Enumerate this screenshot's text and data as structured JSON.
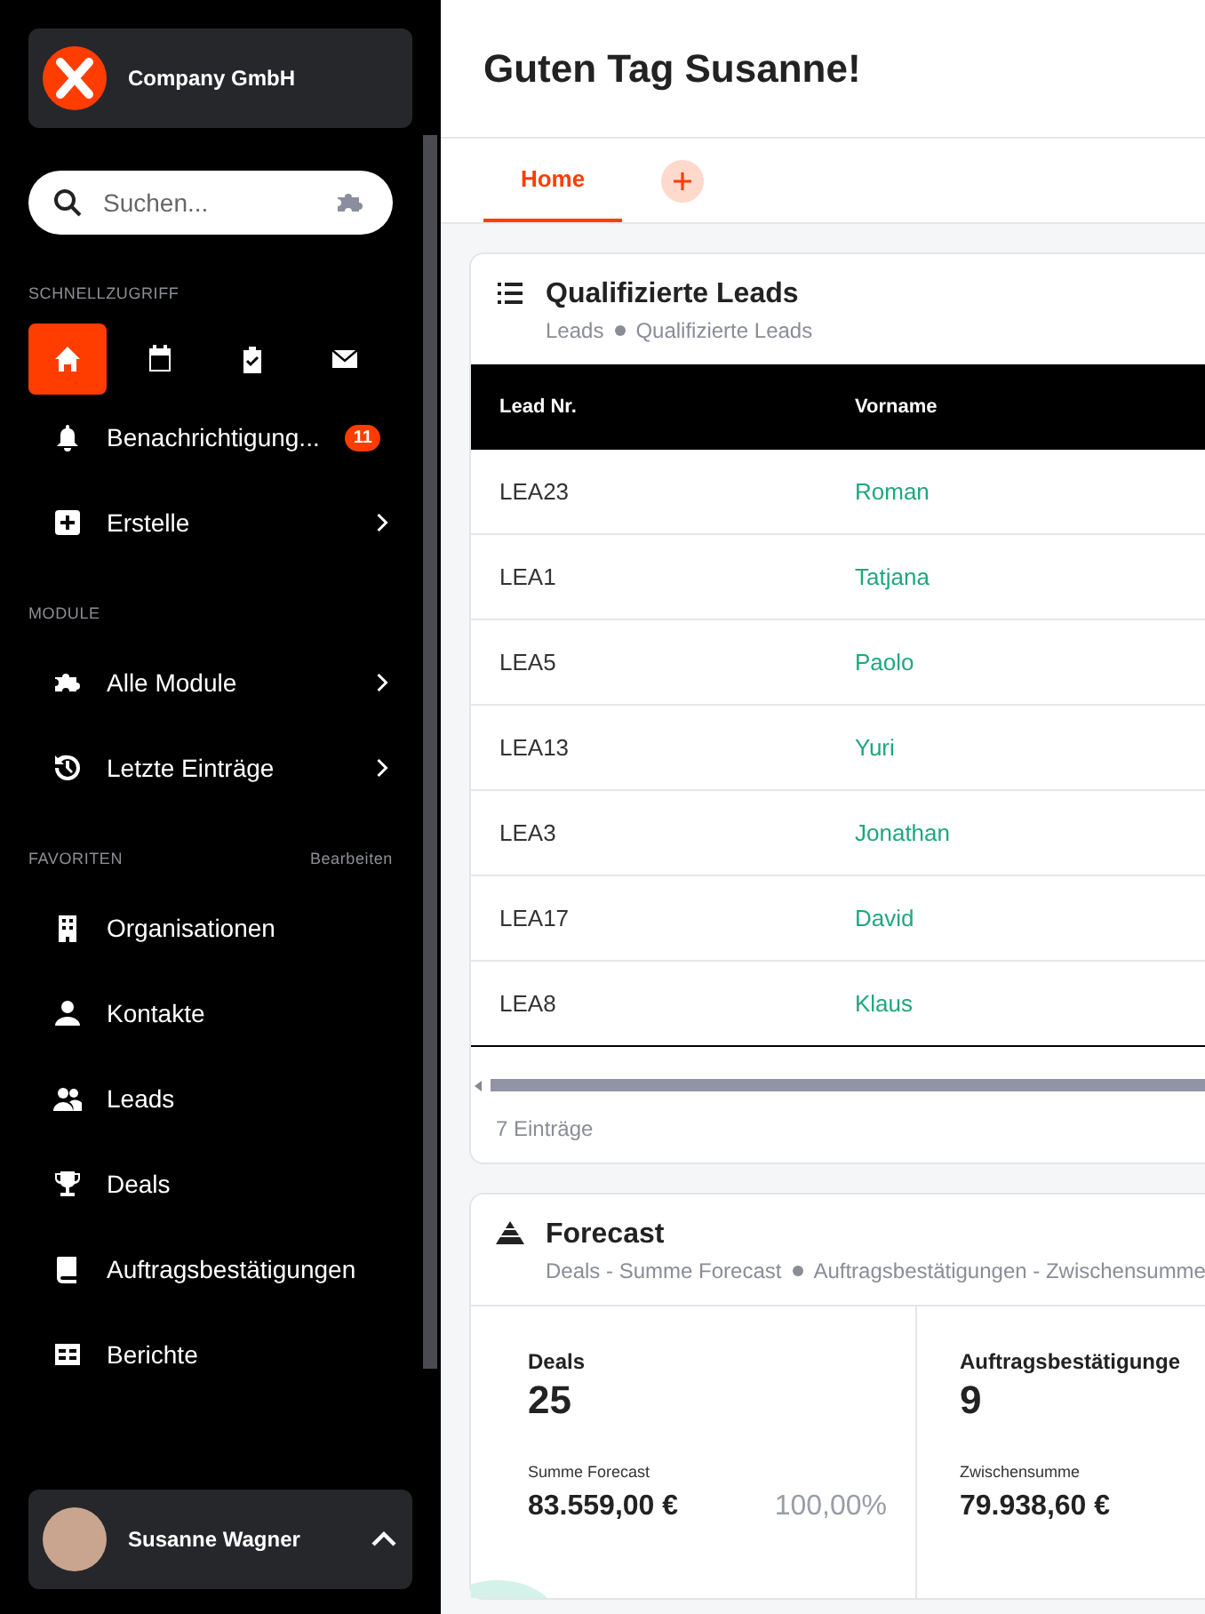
{
  "sidebar": {
    "company": "Company GmbH",
    "search": {
      "placeholder": "Suchen..."
    },
    "quick_access": {
      "label": "SCHNELLZUGRIFF",
      "items": [
        {
          "selected": true
        },
        {
          "selected": false
        },
        {
          "selected": false
        },
        {
          "selected": false
        }
      ]
    },
    "top_items": [
      {
        "kind": "badge",
        "label": "Benachrichtigung...",
        "badge": "11"
      },
      {
        "kind": "submenu",
        "label": "Erstelle"
      }
    ],
    "modules": {
      "label": "MODULE",
      "items": [
        {
          "kind": "submenu",
          "label": "Alle Module"
        },
        {
          "kind": "submenu",
          "label": "Letzte Einträge"
        }
      ]
    },
    "favorites": {
      "label": "FAVORITEN",
      "edit": "Bearbeiten",
      "items": [
        {
          "label": "Organisationen"
        },
        {
          "label": "Kontakte"
        },
        {
          "label": "Leads"
        },
        {
          "label": "Deals"
        },
        {
          "label": "Auftragsbestätigungen"
        },
        {
          "label": "Berichte"
        }
      ]
    },
    "user": {
      "name": "Susanne Wagner"
    }
  },
  "header": {
    "title": "Guten Tag Susanne!"
  },
  "tabs": [
    {
      "label": "Home",
      "selected": true
    }
  ],
  "leads_card": {
    "title": "Qualifizierte Leads",
    "breadcrumb": [
      "Leads",
      "Qualifizierte Leads"
    ],
    "table": {
      "columns": [
        "Lead Nr.",
        "Vorname"
      ],
      "rows": [
        [
          "LEA23",
          "Roman"
        ],
        [
          "LEA1",
          "Tatjana"
        ],
        [
          "LEA5",
          "Paolo"
        ],
        [
          "LEA13",
          "Yuri"
        ],
        [
          "LEA3",
          "Jonathan"
        ],
        [
          "LEA17",
          "David"
        ],
        [
          "LEA8",
          "Klaus"
        ]
      ]
    },
    "footer": "7 Einträge"
  },
  "forecast_card": {
    "title": "Forecast",
    "breadcrumb": [
      "Deals - Summe Forecast",
      "Auftragsbestätigungen - Zwischensumme"
    ],
    "stats": [
      {
        "title": "Deals",
        "count": "25",
        "sublabel": "Summe Forecast",
        "amount": "83.559,00 €",
        "percent": "100,00%"
      },
      {
        "title": "Auftragsbestätigunge",
        "count": "9",
        "sublabel": "Zwischensumme",
        "amount": "79.938,60 €"
      }
    ]
  }
}
